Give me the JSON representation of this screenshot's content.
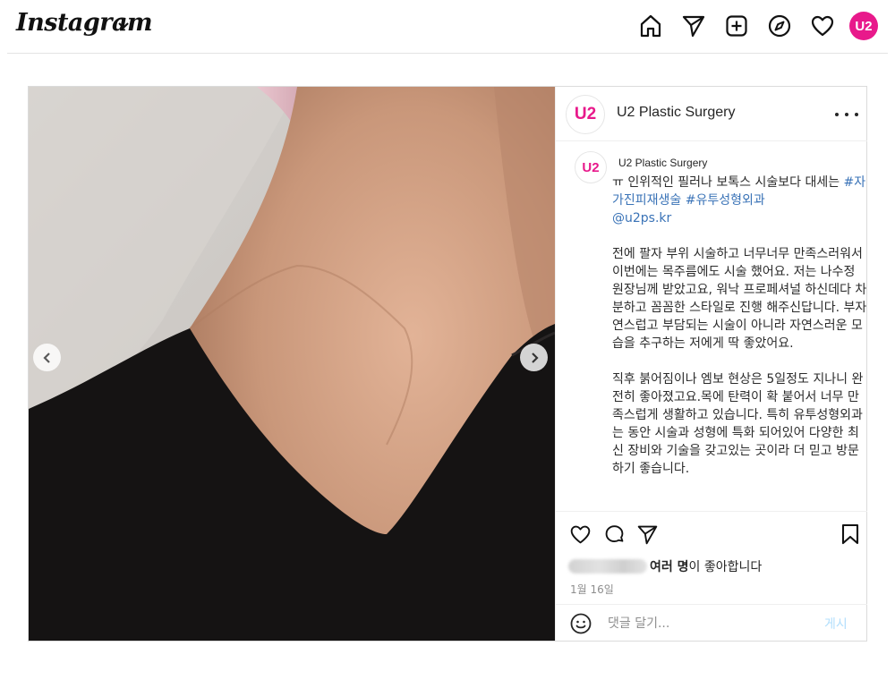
{
  "nav": {
    "logo": "Instagram",
    "avatar_text": "U2",
    "icons": [
      "home-icon",
      "direct-message-icon",
      "new-post-icon",
      "explore-icon",
      "activity-heart-icon",
      "profile-avatar"
    ]
  },
  "post": {
    "author": "U2 Plastic Surgery",
    "avatar_text": "U2",
    "caption": {
      "line1_prefix": "ㅠ 인위적인 필러나 보톡스 시술보다 대세는 ",
      "hashtag1": "#자가진피재생술",
      "hashtag2": "#유투성형외과",
      "mention": "@u2ps.kr",
      "paragraph1": "전에 팔자 부위 시술하고 너무너무 만족스러워서 이번에는 목주름에도 시술 했어요. 저는 나수정 원장님께 받았고요, 워낙 프로페셔널 하신데다 차분하고 꼼꼼한 스타일로 진행 해주신답니다. 부자연스럽고 부담되는 시술이 아니라 자연스러운 모습을 추구하는 저에게 딱 좋았어요.",
      "paragraph2": "직후 붉어짐이나 엠보 현상은 5일정도 지나니 완전히 좋아졌고요.목에 탄력이 확 붙어서 너무 만족스럽게 생활하고 있습니다. 특히 유투성형외과는 동안 시술과 성형에 특화 되어있어 다양한 최신 장비와 기술을 갖고있는 곳이라 더 믿고 방문하기 좋습니다."
    },
    "likes_bold": "여러 명",
    "likes_suffix": "이 좋아합니다",
    "date": "1월 16일",
    "comment_placeholder": "댓글 달기...",
    "post_button": "게시"
  },
  "colors": {
    "brand_pink": "#e8198b",
    "hashtag_blue": "#3a73b7",
    "post_button_disabled": "#b2dffc"
  }
}
